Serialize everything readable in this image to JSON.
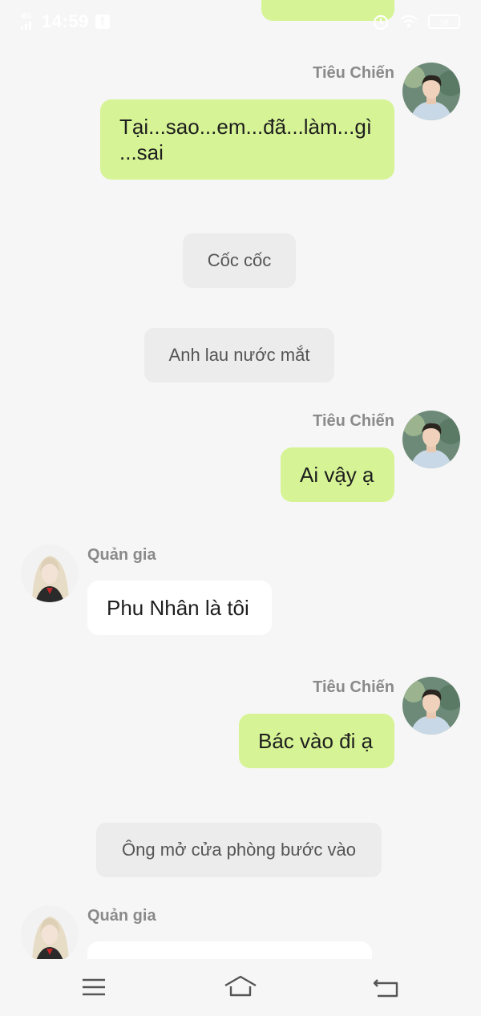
{
  "status_bar": {
    "network": "4G",
    "time": "14:59",
    "notification": "f",
    "battery": "38"
  },
  "messages": [
    {
      "sender": "Tiêu Chiến",
      "text": "Tại...sao...em...đã...làm...gì\n...sai"
    },
    {
      "narration": "Cốc cốc"
    },
    {
      "narration": "Anh lau nước mắt"
    },
    {
      "sender": "Tiêu Chiến",
      "text": "Ai vậy ạ"
    },
    {
      "sender": "Quản gia",
      "text": "Phu Nhân là tôi"
    },
    {
      "sender": "Tiêu Chiến",
      "text": "Bác vào đi ạ"
    },
    {
      "narration": "Ông mở cửa phòng bước vào"
    },
    {
      "sender": "Quản gia",
      "text": ""
    }
  ],
  "colors": {
    "background": "#f6f6f6",
    "sent_bubble": "#d6f495",
    "received_bubble": "#ffffff",
    "narration_bubble": "#ececec",
    "name_text": "#8a8a8a"
  },
  "icons": {
    "menu": "menu-icon",
    "home": "home-icon",
    "back": "back-icon"
  }
}
